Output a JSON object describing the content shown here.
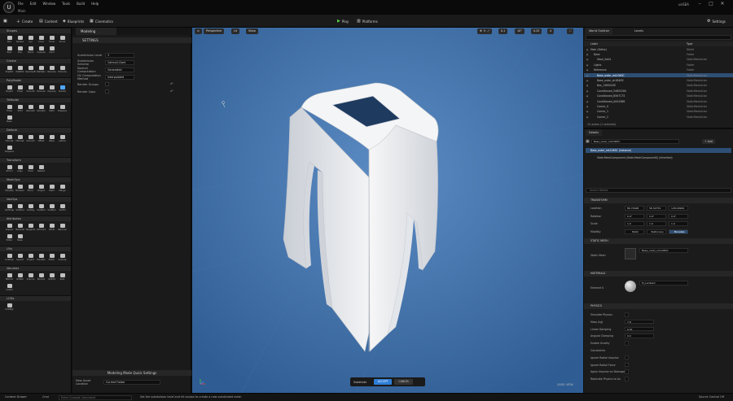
{
  "titlebar": {
    "menu": [
      "File",
      "Edit",
      "Window",
      "Tools",
      "Build",
      "Help"
    ],
    "tab": "Main",
    "project": "unSEA"
  },
  "toolbar": {
    "create": "Create",
    "content": "Content",
    "blueprints": "Blueprints",
    "cinematics": "Cinematics",
    "play": "Play",
    "platforms": "Platforms",
    "settings": "Settings"
  },
  "palette": [
    {
      "title": "Shapes",
      "tools": [
        "Box",
        "Sphere",
        "Cyl",
        "Cone",
        "Torus",
        "Arrow",
        "Rect",
        "Disc",
        "Stairs",
        "Capsule",
        "Solid"
      ]
    },
    {
      "title": "Create",
      "tools": [
        "PolyExt",
        "PathExt",
        "RevolveB",
        "PathRev",
        "Revolve",
        "Extrude"
      ]
    },
    {
      "title": "PolyModel",
      "tools": [
        "PolyEd",
        "TriSel",
        "Smooth",
        "Extrude",
        "PolyGrp",
        "SubDiv"
      ]
    },
    {
      "title": "TriModel",
      "tools": [
        "TriSel",
        "TriEd",
        "Remesh",
        "Simplify",
        "Weld",
        "Displace",
        "Bake"
      ]
    },
    {
      "title": "Deform",
      "tools": [
        "VSculpt",
        "DSculpt",
        "Smooth",
        "Offset",
        "Warp",
        "Lattice",
        "Displace"
      ]
    },
    {
      "title": "Transform",
      "tools": [
        "XForm",
        "Align",
        "Pivot",
        "Bakexf"
      ]
    },
    {
      "title": "MeshOps",
      "tools": [
        "Simplify",
        "Boolean",
        "Mirror",
        "Project",
        "Weld",
        "Merge"
      ]
    },
    {
      "title": "VoxOps",
      "tools": [
        "VoxWrap",
        "VoxBool",
        "VoxMrg",
        "VoxBlnd",
        "VoxMph",
        "VoxFill"
      ]
    },
    {
      "title": "Attributes",
      "tools": [
        "Inspect",
        "Normals",
        "Tangents",
        "UVCoord",
        "Attrib",
        "Remove",
        "Editor",
        "Mask"
      ]
    },
    {
      "title": "UVs",
      "tools": [
        "UnWrap",
        "Layout",
        "Project",
        "Transfer",
        "Editor",
        "Unwrap"
      ]
    },
    {
      "title": "Volumes",
      "tools": [
        "MshVol",
        "VolMsh",
        "Volume",
        "BoolVol",
        "VolEdit",
        "Split",
        "CutVol"
      ]
    },
    {
      "title": "LODs",
      "tools": [
        "LODMgr"
      ]
    }
  ],
  "settings": {
    "tab": "Modeling",
    "section": "SETTINGS",
    "props": [
      {
        "label": "Subdivision Level",
        "value": "3"
      },
      {
        "label": "Subdivision Scheme",
        "value": "Catmull-Clark"
      },
      {
        "label": "Normal Computation",
        "value": "Generated"
      },
      {
        "label": "UV Computation Method",
        "value": "Interpolated"
      },
      {
        "label": "Render Groups",
        "value": ""
      },
      {
        "label": "Render Caps",
        "value": ""
      }
    ],
    "quick": "Modeling Mode Quick Settings",
    "asset_label": "New Asset Location",
    "asset_value": "Current Folder"
  },
  "viewport": {
    "buttons": [
      "Perspective",
      "Lit",
      "Show"
    ],
    "right": [
      "0.1",
      "10°",
      "0.25",
      "4"
    ],
    "accept_label": "Subdivide",
    "accept": "ACCEPT",
    "cancel": "CANCEL",
    "persp": "LEVEL VIEW"
  },
  "outliner": {
    "tabs": [
      "World Outliner",
      "Levels"
    ],
    "col_label": "Label",
    "col_type": "Type",
    "rows": [
      {
        "name": "Main (Editor)",
        "type": "World",
        "sel": false
      },
      {
        "name": "Base",
        "type": "Folder",
        "sel": false
      },
      {
        "name": "Stool_Solid",
        "type": "StaticMeshActor",
        "sel": false
      },
      {
        "name": "Lights",
        "type": "Folder",
        "sel": false
      },
      {
        "name": "Reference",
        "type": "Folder",
        "sel": false
      },
      {
        "name": "Base_outer_mk1083C",
        "type": "StaticMeshActor",
        "sel": true
      },
      {
        "name": "Base_outer_sk1B4MC",
        "type": "StaticMeshActor",
        "sel": false
      },
      {
        "name": "Box_1365043E",
        "type": "StaticMeshActor",
        "sel": false
      },
      {
        "name": "Conditioned_54603260",
        "type": "StaticMeshActor",
        "sel": false
      },
      {
        "name": "Conditioned_B567C75",
        "type": "StaticMeshActor",
        "sel": false
      },
      {
        "name": "Conditioned_A0043BB",
        "type": "StaticMeshActor",
        "sel": false
      },
      {
        "name": "Corner_0",
        "type": "StaticMeshActor",
        "sel": false
      },
      {
        "name": "Corner_1",
        "type": "StaticMeshActor",
        "sel": false
      },
      {
        "name": "Corner_2",
        "type": "StaticMeshActor",
        "sel": false
      }
    ],
    "count": "15 actors (1 selected)"
  },
  "details": {
    "tab": "Details",
    "name": "Base_outer_mk1083C",
    "add": "+ Add",
    "component": "Base_outer_mk1083C (Instance)",
    "subcomponent": "StaticMeshComponent (StaticMeshComponent0) (Inherited)",
    "search": "Search Details",
    "transform": "TRANSFORM",
    "loc_label": "Location",
    "rot_label": "Rotation",
    "scale_label": "Scale",
    "loc": [
      "86.74648",
      "58.32379",
      "128.09999"
    ],
    "rot": [
      "0.0°",
      "0.0°",
      "0.0°"
    ],
    "scale": [
      "1.0",
      "1.0",
      "1.0"
    ],
    "mobility": "Mobility",
    "mob": [
      "Static",
      "Stationary",
      "Movable"
    ],
    "static_mesh": "STATIC MESH",
    "sm_label": "Static Mesh",
    "sm_value": "Base_outer_mk1083C",
    "materials": "MATERIALS",
    "el_label": "Element 0",
    "mat_value": "M_Lambert",
    "physics": "PHYSICS",
    "phys_rows": [
      "Simulate Physics",
      "Mass (kg)",
      "Linear Damping",
      "Angular Damping",
      "Enable Gravity",
      "Constraints",
      "Ignore Radial Impulse",
      "Ignore Radial Force",
      "Apply Impulse on Damage",
      "Replicate Physics to Au"
    ],
    "phys_vals": [
      "",
      "7.8",
      "0.01",
      "0.0"
    ]
  },
  "status": {
    "drawer": "Content Drawer",
    "cmd": "Cmd",
    "console": "Enter Console Command",
    "msg": "Set the subdivision level and hit accept to create a new subdivided mesh",
    "source": "Source Control Off"
  }
}
